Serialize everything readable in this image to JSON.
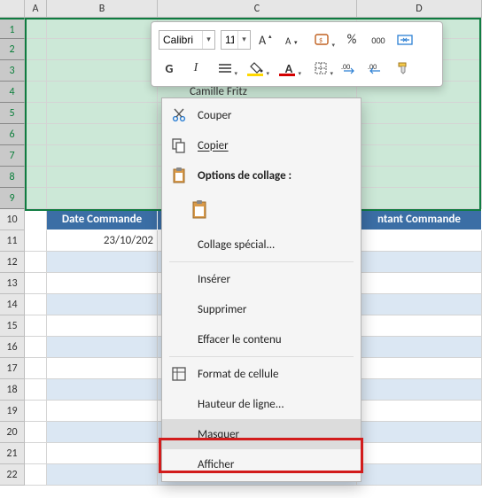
{
  "columns": [
    "A",
    "B",
    "C",
    "D"
  ],
  "rows": [
    "1",
    "2",
    "3",
    "4",
    "5",
    "6",
    "7",
    "8",
    "9",
    "10",
    "11",
    "12",
    "13",
    "14",
    "15",
    "16",
    "17",
    "18",
    "19",
    "20",
    "21",
    "22"
  ],
  "cells": {
    "C4": "Camille Fritz",
    "B10": "Date Commande",
    "D10": "ntant Commande",
    "B11": "23/10/202"
  },
  "mini_toolbar": {
    "font_name": "Calibri",
    "font_size": "11",
    "bold": "G",
    "italic": "I",
    "percent": "%",
    "thousands": "000"
  },
  "context_menu": {
    "cut": "Couper",
    "copy": "Copier",
    "paste_options": "Options de collage :",
    "paste_special": "Collage spécial...",
    "insert": "Insérer",
    "delete": "Supprimer",
    "clear": "Effacer le contenu",
    "format_cells": "Format de cellule",
    "row_height": "Hauteur de ligne...",
    "hide": "Masquer",
    "unhide": "Afficher"
  }
}
